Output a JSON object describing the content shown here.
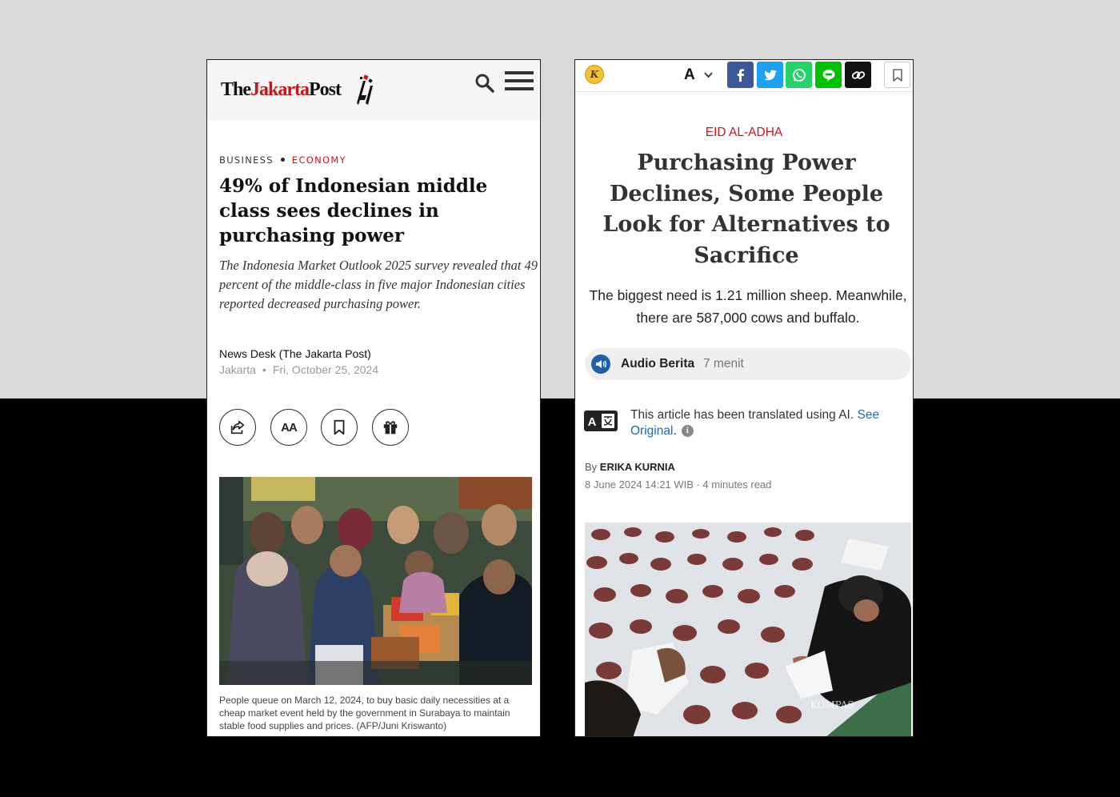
{
  "left": {
    "logo": {
      "the": "The",
      "jakarta": "Jakarta",
      "post": "Post"
    },
    "categories": {
      "primary": "BUSINESS",
      "secondary": "ECONOMY"
    },
    "headline": "49% of Indonesian middle class sees declines in purchasing power",
    "standfirst": "The Indonesia Market Outlook 2025 survey revealed that 49 percent of the middle-class in five major Indonesian cities reported decreased purchasing power.",
    "author": "News Desk (The Jakarta Post)",
    "location": "Jakarta",
    "date": "Fri, October 25, 2024",
    "actions": {
      "font_size_label": "AA"
    },
    "caption": "People queue on March 12, 2024, to buy basic daily necessities at a cheap market event held by the government in Surabaya to maintain stable food supplies and prices. (AFP/Juni Kriswanto)",
    "colors": {
      "brand_red": "#c4161c"
    }
  },
  "right": {
    "logo_letter": "K",
    "font_button": "A",
    "share_colors": {
      "facebook": "#3b5998",
      "twitter": "#1da1f2",
      "whatsapp": "#25d366",
      "line": "#00c300",
      "link": "#111111"
    },
    "kicker": "EID AL-ADHA",
    "headline": "Purchasing Power Declines, Some People Look for Alternatives to Sacrifice",
    "lede": "The biggest need is 1.21 million sheep. Meanwhile, there are 587,000 cows and buffalo.",
    "audio": {
      "label": "Audio Berita",
      "duration": "7 menit"
    },
    "ai_notice": {
      "text": "This article has been translated using AI.",
      "link1": "See",
      "link2": "Original",
      "period": ".",
      "info": "i"
    },
    "byline": {
      "prefix": "By",
      "author": "ERIKA KURNIA"
    },
    "date": "8 June 2024 14:21 WIB · 4 minutes read",
    "photo_watermark": "KOMPAS"
  }
}
